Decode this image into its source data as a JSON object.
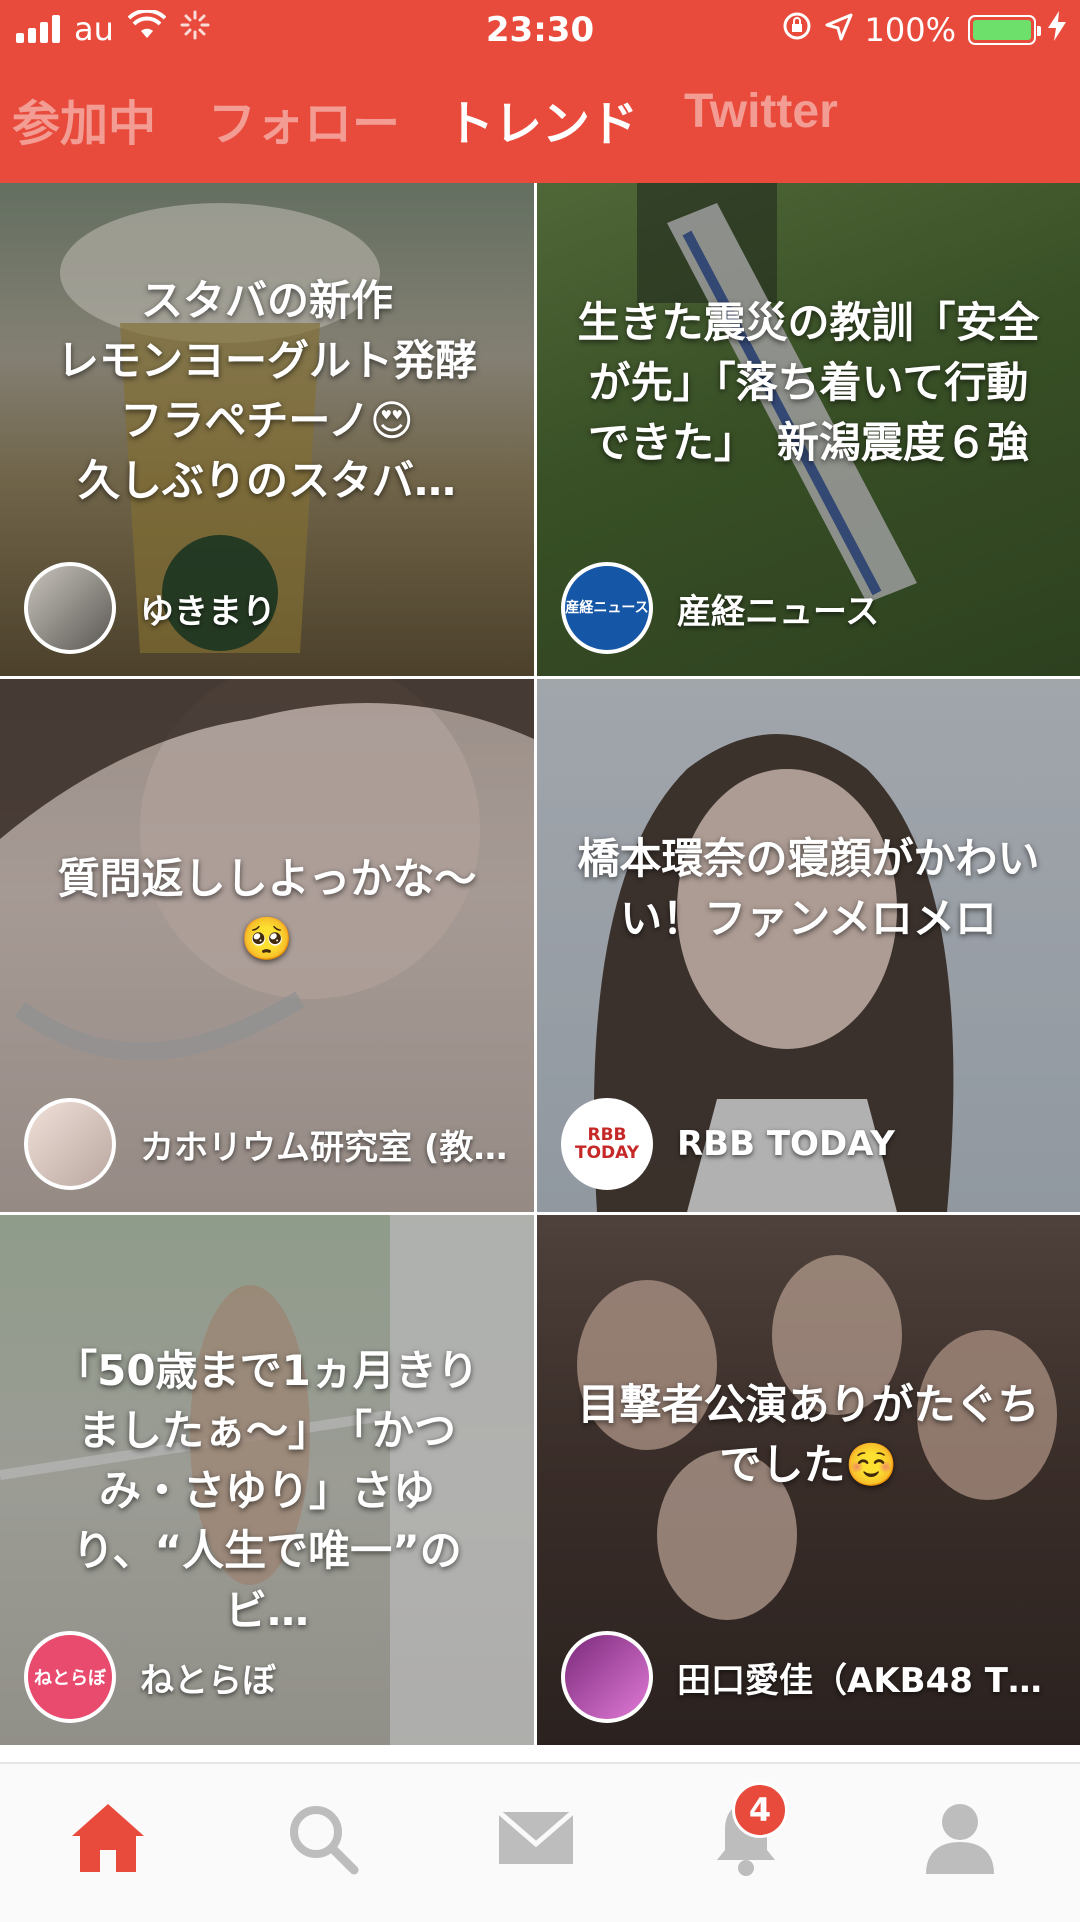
{
  "status_bar": {
    "carrier": "au",
    "time": "23:30",
    "battery": "100%"
  },
  "tabs": [
    {
      "label": "参加中"
    },
    {
      "label": "フォロー"
    },
    {
      "label": "トレンド"
    },
    {
      "label": "Twitter"
    }
  ],
  "cards": [
    {
      "title": "スタバの新作\nレモンヨーグルト発酵フラペチーノ😍\n久しぶりのスタバ…",
      "source": "ゆきまり"
    },
    {
      "title": "生きた震災の教訓「安全が先」「落ち着いて行動できた」　新潟震度６強",
      "source": "産経ニュース",
      "avatar_text": "産経ニュース"
    },
    {
      "title": "質問返ししよっかな〜\n🥺",
      "source": "カホリウム研究室 (教…"
    },
    {
      "title": "橋本環奈の寝顔がかわいい！ファンメロメロ",
      "source": "RBB TODAY",
      "avatar_text": "RBB TODAY"
    },
    {
      "title": "「50歳まで1ヵ月きりましたぁ〜」　「かつみ・さゆり」さゆり、“人生で唯一”のビ…",
      "source": "ねとらぼ",
      "avatar_text": "ねとらぼ"
    },
    {
      "title": "目撃者公演ありがたぐちでした☺️",
      "source": "田口愛佳（AKB48 T…"
    }
  ],
  "bottom_nav": {
    "notification_count": "4"
  }
}
